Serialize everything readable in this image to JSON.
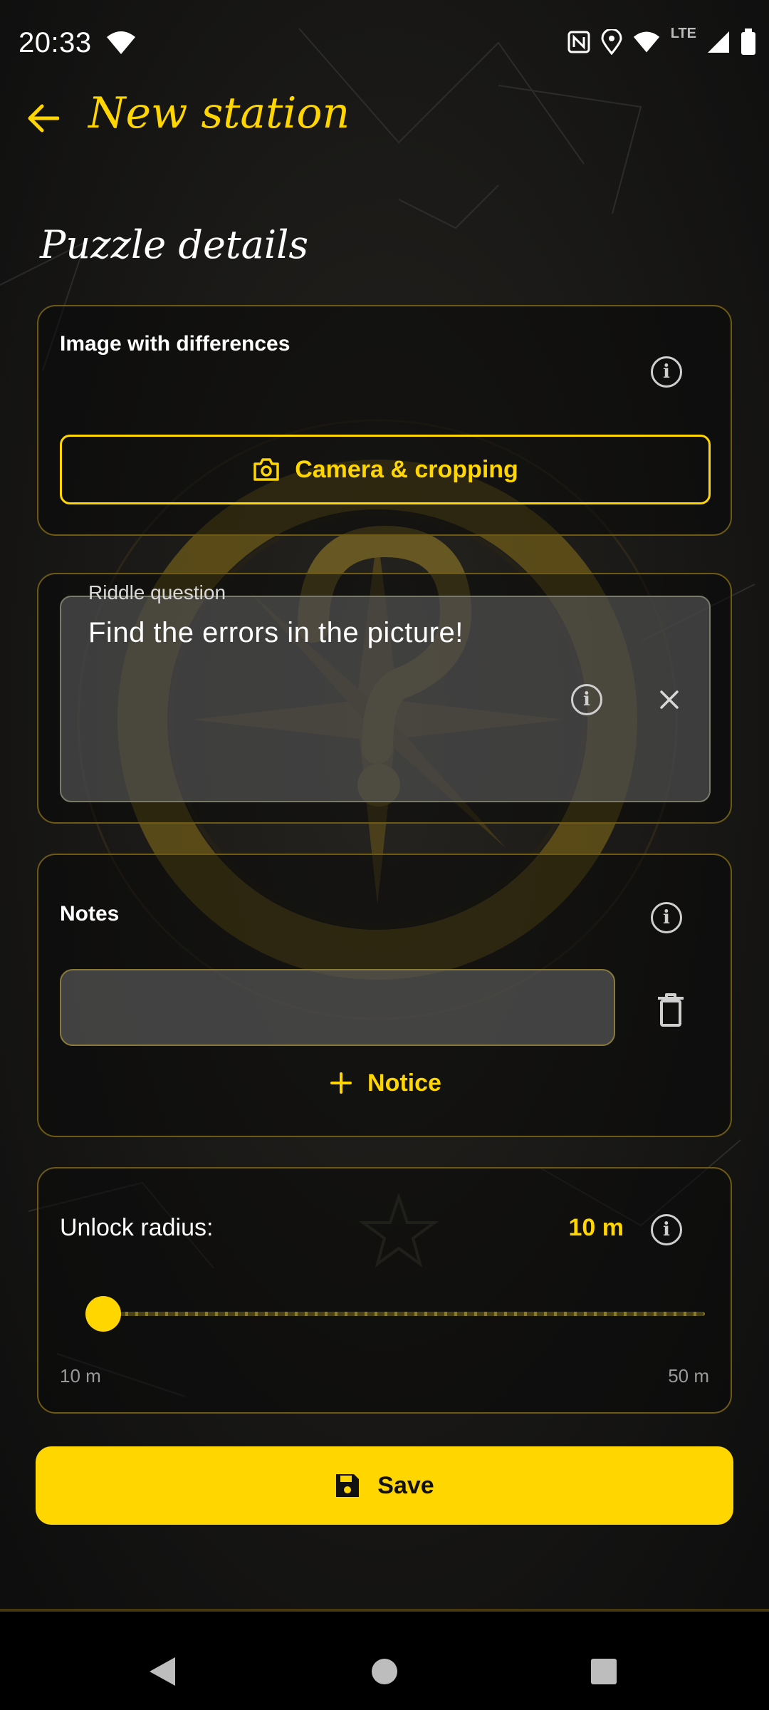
{
  "status_bar": {
    "time": "20:33",
    "network": "LTE",
    "icons": [
      "wifi-icon",
      "nfc-icon",
      "location-icon",
      "wifi-icon",
      "signal-icon",
      "battery-icon"
    ]
  },
  "app_bar": {
    "title": "New station",
    "back_icon": "arrow-left-icon"
  },
  "section_title": "Puzzle details",
  "image_card": {
    "label": "Image with differences",
    "camera_button_label": "Camera & cropping"
  },
  "riddle_card": {
    "field_label": "Riddle question",
    "field_value": "Find the errors in the picture!"
  },
  "notes_card": {
    "label": "Notes",
    "note_value": "",
    "add_button_label": "Notice"
  },
  "radius_card": {
    "label": "Unlock radius:",
    "value_text": "10 m",
    "min_label": "10 m",
    "max_label": "50 m",
    "value": 10,
    "min": 10,
    "max": 50
  },
  "save_button_label": "Save",
  "colors": {
    "accent": "#FFD600",
    "background": "#141414",
    "card_border": "#6e5a14",
    "field_fill": "#646464"
  }
}
